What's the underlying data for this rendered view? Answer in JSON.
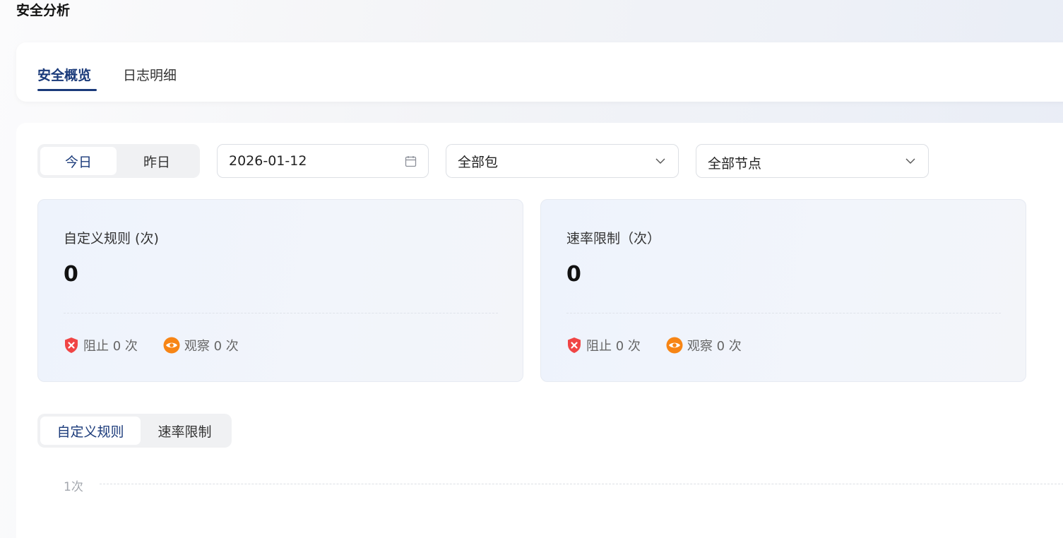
{
  "page": {
    "title": "安全分析"
  },
  "tabs": [
    {
      "label": "安全概览",
      "active": true
    },
    {
      "label": "日志明细",
      "active": false
    }
  ],
  "filters": {
    "day_toggle": [
      {
        "label": "今日",
        "active": true
      },
      {
        "label": "昨日",
        "active": false
      }
    ],
    "date": {
      "value": "2026-01-12",
      "icon": "calendar-icon"
    },
    "package": {
      "value": "全部包",
      "icon": "chevron-down-icon"
    },
    "node": {
      "value": "全部节点",
      "icon": "chevron-down-icon"
    }
  },
  "stats": [
    {
      "label": "自定义规则 (次)",
      "value": "0",
      "block": {
        "label": "阻止 0 次",
        "icon": "block-shield-icon",
        "color": "#f04545"
      },
      "observe": {
        "label": "观察 0 次",
        "icon": "eye-icon",
        "color": "#f78515"
      }
    },
    {
      "label": "速率限制（次）",
      "value": "0",
      "block": {
        "label": "阻止 0 次",
        "icon": "block-shield-icon",
        "color": "#f04545"
      },
      "observe": {
        "label": "观察 0 次",
        "icon": "eye-icon",
        "color": "#f78515"
      }
    }
  ],
  "chart_toggle": [
    {
      "label": "自定义规则",
      "active": true
    },
    {
      "label": "速率限制",
      "active": false
    }
  ],
  "chart": {
    "y_tick": "1次"
  },
  "colors": {
    "accent": "#1a3a7a",
    "block": "#f04545",
    "observe": "#f78515"
  }
}
